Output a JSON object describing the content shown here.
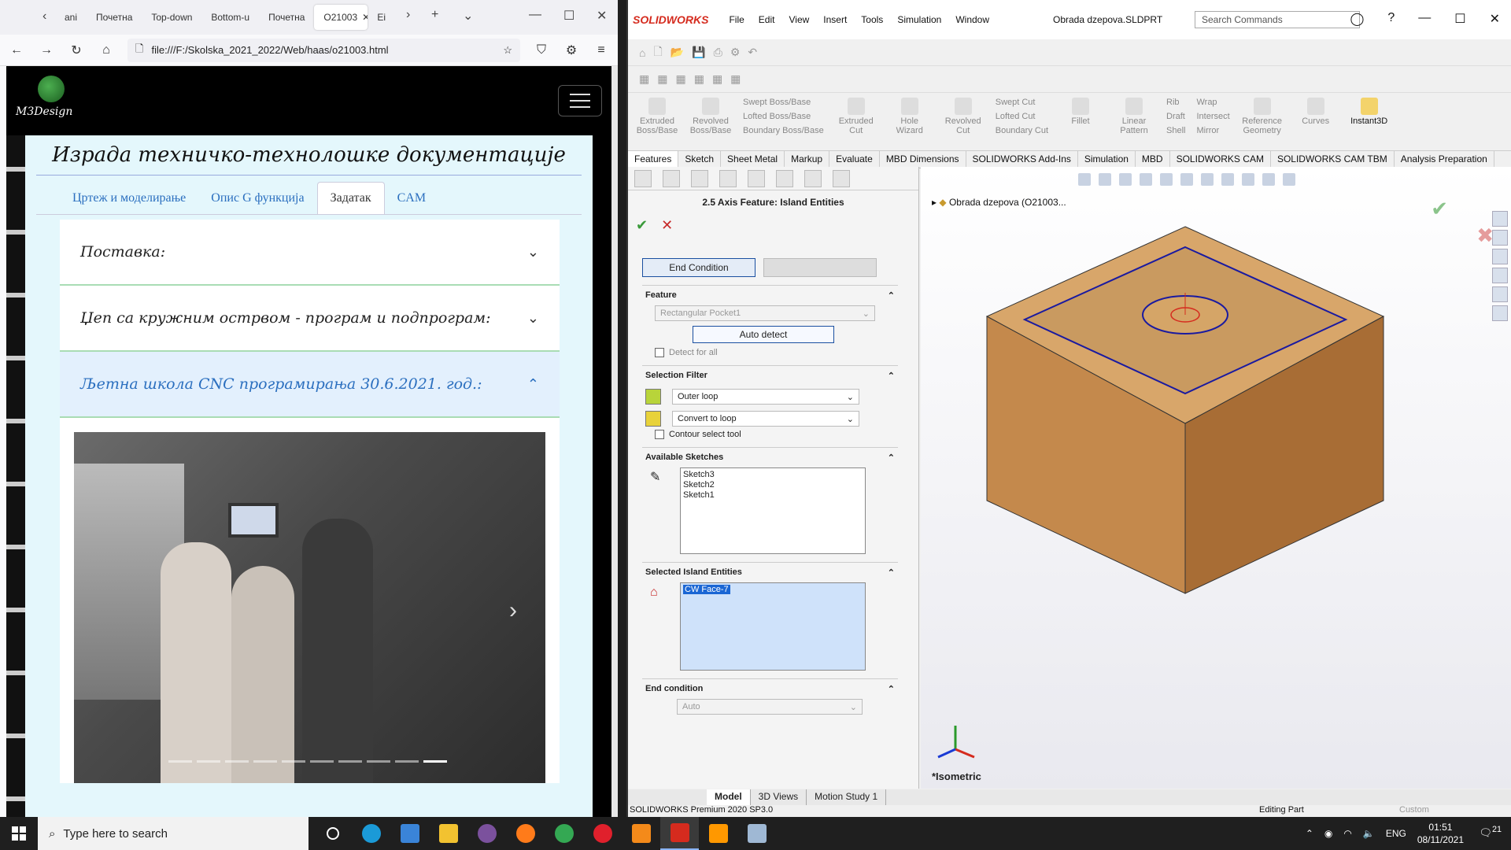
{
  "browser": {
    "tabs": [
      {
        "label": "ani"
      },
      {
        "label": "Почетна"
      },
      {
        "label": "Top-down"
      },
      {
        "label": "Bottom-u"
      },
      {
        "label": "Почетна"
      },
      {
        "label": "O21003"
      },
      {
        "label": "Ei"
      }
    ],
    "url": "file:///F:/Skolska_2021_2022/Web/haas/o21003.html",
    "site": {
      "logo_text": "M3Design",
      "title": "Израда техничко-технолошке документације",
      "tabs": [
        "Цртеж и моделирање",
        "Опис G функција",
        "Задатак",
        "CAM"
      ],
      "active_tab": "Задатак",
      "accordion": [
        {
          "label": "Поставка:"
        },
        {
          "label": "Џеп са кружним острвом - програм и подпрограм:"
        },
        {
          "label": "Љетна школа CNC програмирања 30.6.2021. год.:"
        }
      ],
      "carousel_count": 10,
      "carousel_active": 10
    }
  },
  "solidworks": {
    "app_name": "SOLIDWORKS",
    "menu": [
      "File",
      "Edit",
      "View",
      "Insert",
      "Tools",
      "Simulation",
      "Window"
    ],
    "file_name": "Obrada dzepova.SLDPRT",
    "search_placeholder": "Search Commands",
    "commands": {
      "extruded_boss": "Extruded Boss/Base",
      "revolved_boss": "Revolved Boss/Base",
      "swept_boss": "Swept Boss/Base",
      "lofted_boss": "Lofted Boss/Base",
      "boundary_boss": "Boundary Boss/Base",
      "extruded_cut": "Extruded Cut",
      "hole_wizard": "Hole Wizard",
      "revolved_cut": "Revolved Cut",
      "swept_cut": "Swept Cut",
      "lofted_cut": "Lofted Cut",
      "boundary_cut": "Boundary Cut",
      "fillet": "Fillet",
      "linear_pattern": "Linear Pattern",
      "rib": "Rib",
      "draft": "Draft",
      "shell": "Shell",
      "wrap": "Wrap",
      "intersect": "Intersect",
      "mirror": "Mirror",
      "reference_geometry": "Reference Geometry",
      "curves": "Curves",
      "instant3d": "Instant3D"
    },
    "cmd_tabs": [
      "Features",
      "Sketch",
      "Sheet Metal",
      "Markup",
      "Evaluate",
      "MBD Dimensions",
      "SOLIDWORKS Add-Ins",
      "Simulation",
      "MBD",
      "SOLIDWORKS CAM",
      "SOLIDWORKS CAM TBM",
      "Analysis Preparation"
    ],
    "pm": {
      "title": "2.5 Axis Feature: Island Entities",
      "end_condition_tab": "End Condition",
      "feature_header": "Feature",
      "feature_value": "Rectangular Pocket1",
      "auto_detect": "Auto detect",
      "detect_for_all": "Detect for all",
      "selection_filter_header": "Selection Filter",
      "filter1": "Outer loop",
      "filter2": "Convert to loop",
      "contour_tool": "Contour select tool",
      "available_sketches_header": "Available Sketches",
      "sketches": [
        "Sketch3",
        "Sketch2",
        "Sketch1"
      ],
      "selected_island_header": "Selected Island Entities",
      "selected_island": "CW Face-7",
      "end_condition_header": "End condition",
      "end_condition_value": "Auto"
    },
    "tree_root": "Obrada dzepova  (O21003...",
    "view_name": "*Isometric",
    "bottom_tabs": [
      "Model",
      "3D Views",
      "Motion Study 1"
    ],
    "status_left": "SOLIDWORKS Premium 2020 SP3.0",
    "status_mid": "Editing Part",
    "status_right": "Custom",
    "colors": {
      "accent_red": "#d52b1e",
      "ok_green": "#3a9a3a",
      "selection_blue": "#1a66d4",
      "wood": "#c18a4e"
    }
  },
  "taskbar": {
    "search_placeholder": "Type here to search",
    "lang": "ENG",
    "time": "01:51",
    "date": "08/11/2021",
    "notifications": "21"
  }
}
